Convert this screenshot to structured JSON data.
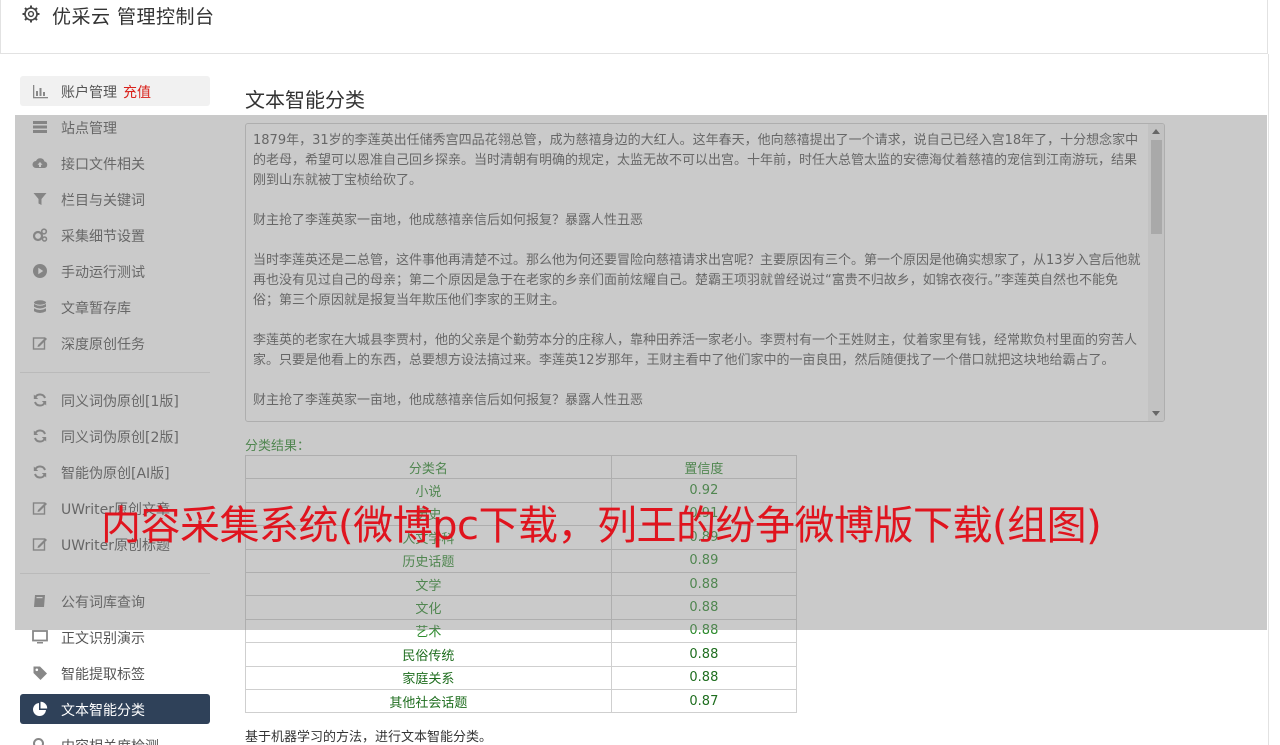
{
  "header": {
    "title": "优采云 管理控制台",
    "icon": "gear-icon"
  },
  "sidebar": {
    "items": [
      {
        "label": "账户管理",
        "badge": "充值",
        "icon": "bar-chart-icon"
      },
      {
        "label": "站点管理",
        "icon": "server-icon"
      },
      {
        "label": "接口文件相关",
        "icon": "cloud-upload-icon"
      },
      {
        "label": "栏目与关键词",
        "icon": "filter-icon"
      },
      {
        "label": "采集细节设置",
        "icon": "cogs-icon"
      },
      {
        "label": "手动运行测试",
        "icon": "play-circle-icon"
      },
      {
        "label": "文章暂存库",
        "icon": "database-icon"
      },
      {
        "label": "深度原创任务",
        "icon": "edit-icon"
      },
      {
        "label": "同义词伪原创[1版]",
        "icon": "refresh-icon"
      },
      {
        "label": "同义词伪原创[2版]",
        "icon": "refresh-icon"
      },
      {
        "label": "智能伪原创[AI版]",
        "icon": "refresh-icon"
      },
      {
        "label": "UWriter原创文章",
        "icon": "edit-icon"
      },
      {
        "label": "UWriter原创标题",
        "icon": "edit-icon"
      },
      {
        "label": "公有词库查询",
        "icon": "book-icon"
      },
      {
        "label": "正文识别演示",
        "icon": "monitor-icon"
      },
      {
        "label": "智能提取标签",
        "icon": "tag-icon"
      },
      {
        "label": "文本智能分类",
        "icon": "pie-chart-icon"
      },
      {
        "label": "内容相关度检测",
        "icon": "search-icon"
      }
    ]
  },
  "main": {
    "title": "文本智能分类",
    "text_paragraphs": [
      "1879年，31岁的李莲英出任储秀宫四品花翎总管，成为慈禧身边的大红人。这年春天，他向慈禧提出了一个请求，说自己已经入宫18年了，十分想念家中的老母，希望可以恩准自己回乡探亲。当时清朝有明确的规定，太监无故不可以出宫。十年前，时任大总管太监的安德海仗着慈禧的宠信到江南游玩，结果刚到山东就被丁宝桢给砍了。",
      "财主抢了李莲英家一亩地，他成慈禧亲信后如何报复？暴露人性丑恶",
      "当时李莲英还是二总管，这件事他再清楚不过。那么他为何还要冒险向慈禧请求出宫呢？主要原因有三个。第一个原因是他确实想家了，从13岁入宫后他就再也没有见过自己的母亲；第二个原因是急于在老家的乡亲们面前炫耀自己。楚霸王项羽就曾经说过“富贵不归故乡，如锦衣夜行。”李莲英自然也不能免俗；第三个原因就是报复当年欺压他们李家的王财主。",
      "李莲英的老家在大城县李贾村，他的父亲是个勤劳本分的庄稼人，靠种田养活一家老小。李贾村有一个王姓财主，仗着家里有钱，经常欺负村里面的穷苦人家。只要是他看上的东西，总要想方设法搞过来。李莲英12岁那年，王财主看中了他们家中的一亩良田，然后随便找了一个借口就把这块地给霸占了。",
      "财主抢了李莲英家一亩地，他成慈禧亲信后如何报复？暴露人性丑恶"
    ],
    "result_label": "分类结果：",
    "table": {
      "headers": [
        "分类名",
        "置信度"
      ],
      "rows": [
        [
          "小说",
          "0.92"
        ],
        [
          "历史",
          "0.91"
        ],
        [
          "人文学科",
          "0.89"
        ],
        [
          "历史话题",
          "0.89"
        ],
        [
          "文学",
          "0.88"
        ],
        [
          "文化",
          "0.88"
        ],
        [
          "艺术",
          "0.88"
        ],
        [
          "民俗传统",
          "0.88"
        ],
        [
          "家庭关系",
          "0.88"
        ],
        [
          "其他社会话题",
          "0.87"
        ]
      ]
    },
    "footnote": "基于机器学习的方法，进行文本智能分类。"
  },
  "overlay": {
    "caption": "内容采集系统(微博pc下载，列王的纷争微博版下载(组图)"
  },
  "colors": {
    "accent_dark": "#2f4159",
    "result_green": "#2e8b2e",
    "caption_red": "#e0141e",
    "recharge_red": "#d9221c"
  }
}
